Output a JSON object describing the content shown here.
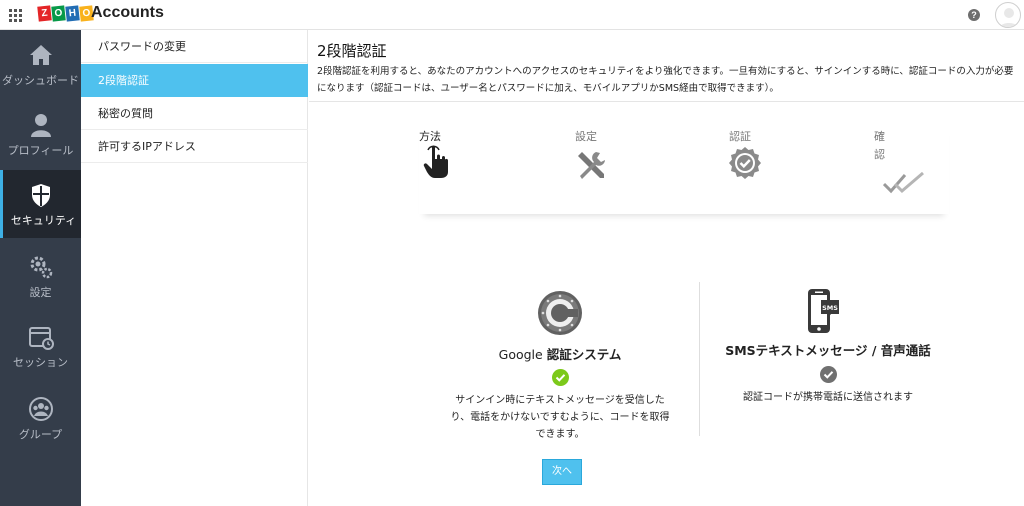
{
  "topbar": {
    "app_name": "Accounts",
    "logo_letters": [
      "Z",
      "O",
      "H",
      "O"
    ],
    "logo_colors": [
      "#e42527",
      "#089949",
      "#226db4",
      "#f9b21d"
    ],
    "help_label": "?"
  },
  "leftnav": {
    "items": [
      {
        "label": "ダッシュボード",
        "icon": "home-icon"
      },
      {
        "label": "プロフィール",
        "icon": "person-icon"
      },
      {
        "label": "セキュリティ",
        "icon": "shield-icon",
        "active": true
      },
      {
        "label": "設定",
        "icon": "gears-icon"
      },
      {
        "label": "セッション",
        "icon": "calendar-clock-icon"
      },
      {
        "label": "グループ",
        "icon": "group-icon"
      }
    ]
  },
  "subnav": {
    "items": [
      {
        "label": "パスワードの変更"
      },
      {
        "label": "2段階認証",
        "active": true
      },
      {
        "label": "秘密の質問"
      },
      {
        "label": "許可するIPアドレス"
      }
    ]
  },
  "main": {
    "title": "2段階認証",
    "description": "2段階認証を利用すると、あなたのアカウントへのアクセスのセキュリティをより強化できます。一旦有効にすると、サインインする時に、認証コードの入力が必要になります（認証コードは、ユーザー名とパスワードに加え、モバイルアプリかSMS経由で取得できます）。",
    "steps": [
      {
        "label": "方法",
        "icon": "pointer-hand-icon",
        "active": true
      },
      {
        "label": "設定",
        "icon": "tools-icon"
      },
      {
        "label": "認証",
        "icon": "badge-check-icon"
      },
      {
        "label": "確認",
        "icon": "double-check-icon"
      }
    ],
    "options": [
      {
        "name_prefix": "Google",
        "name_suffix": "認証システム",
        "description": "サインイン時にテキストメッセージを受信したり、電話をかけないですむように、コードを取得できます。",
        "selected": true,
        "icon": "google-authenticator-icon",
        "check_color": "#7cc91a"
      },
      {
        "name": "SMSテキストメッセージ / 音声通話",
        "description": "認証コードが携帯電話に送信されます",
        "selected": false,
        "icon": "sms-phone-icon",
        "check_color": "#707070"
      }
    ],
    "next_label": "次へ"
  },
  "colors": {
    "accent": "#4fc1ee",
    "nav_bg": "#343d4a",
    "nav_active_bg": "#22272f"
  }
}
